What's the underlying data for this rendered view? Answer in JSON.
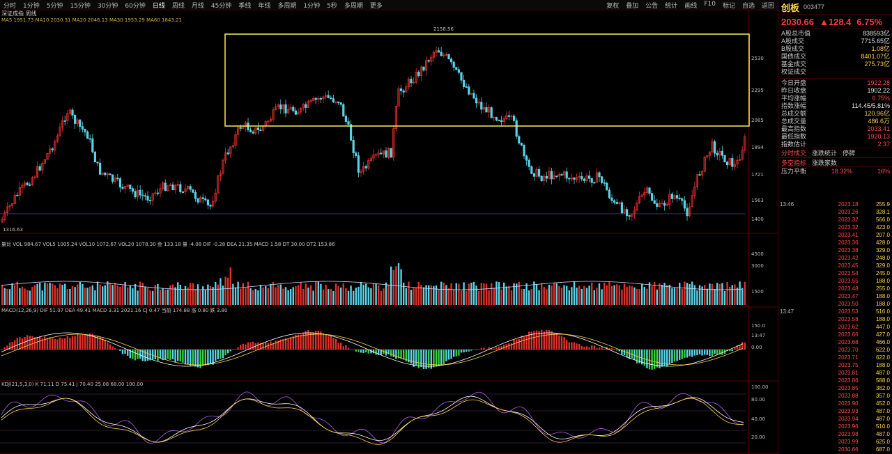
{
  "toolbar": {
    "left": [
      "分时",
      "1分钟",
      "5分钟",
      "15分钟",
      "30分钟",
      "60分钟",
      "日线",
      "周线",
      "月线",
      "45分钟",
      "季线",
      "年线",
      "多周期",
      "1分钟",
      "5秒",
      "多周期",
      "更多"
    ],
    "right": [
      "复权",
      "叠加",
      "公告",
      "统计",
      "画线",
      "F10",
      "标记",
      "自选",
      "返回"
    ]
  },
  "chart_header": {
    "title": "深证成指 周线",
    "ma_line": "MA5 1951.73  MA10 2030.31  MA20 2046.13  MA30 1953.29  MA60 1843.21",
    "high_label": "2158.56",
    "low_label": "1316.63"
  },
  "price_axis": [
    "2530",
    "2295",
    "2085",
    "1894",
    "1721",
    "1563",
    "1400"
  ],
  "volume_header": "量比 VOL 984.67  VOL5 1005.24  VOL10 1072.67  VOL20 1078.30  金 133.18  量 -4.08  DIF -0.28  DEA 21.35  MACD 1.58  DT 30.00  DT2 153.86",
  "volume_axis": [
    "4500",
    "3000",
    "1500"
  ],
  "macd_header": "MACD(12,26,9)  DIF 51.07  DEA 49.41  MACD 3.31  2021.16  CJ 0.47  当前 174.88  涨 0.80  跌 3.80",
  "macd_axis": [
    "150.0",
    "0.00"
  ],
  "kdj_header": "KDJ(21,5,3,0)  K 71.11  D 75.41  J 70.40  25.08  68.00  100.00",
  "kdj_axis": [
    "100.00",
    "80.00",
    "40.00",
    "20.00"
  ],
  "chart_data": {
    "type": "candlestick",
    "title": "",
    "x": [],
    "y_range": [
      1316.63,
      2158.56
    ],
    "panels": [
      "price",
      "volume",
      "macd",
      "kdj"
    ],
    "highlight_box": "consolidation zone (yellow rectangle)"
  },
  "side": {
    "name": "创板",
    "code": "003477",
    "price": "2030.66",
    "change": "▲128.4",
    "pct": "6.75%",
    "section": "A股总市值",
    "section_value": "838593亿",
    "rows1": [
      {
        "l": "A股成交",
        "v": "7715.65亿",
        "c": ""
      },
      {
        "l": "B股成交",
        "v": "1.08亿",
        "c": "yel"
      },
      {
        "l": "国债成交",
        "v": "8401.07亿",
        "c": "yel"
      },
      {
        "l": "基金成交",
        "v": "275.73亿",
        "c": "yel"
      },
      {
        "l": "权证成交",
        "v": "",
        "c": ""
      }
    ],
    "rows2": [
      {
        "l": "今日开盘",
        "v": "1922.28",
        "c": "red"
      },
      {
        "l": "昨日收盘",
        "v": "1902.22",
        "c": ""
      },
      {
        "l": "平均涨幅",
        "v": "6.75%",
        "c": "red"
      },
      {
        "l": "指数涨幅",
        "v": "114.45/5.81%",
        "c": ""
      },
      {
        "l": "总成交额",
        "v": "120.96亿",
        "c": "yel"
      },
      {
        "l": "总成交量",
        "v": "486.6万",
        "c": "yel"
      },
      {
        "l": "最高指数",
        "v": "2033.41",
        "c": "red"
      },
      {
        "l": "最低指数",
        "v": "1920.13",
        "c": "red"
      },
      {
        "l": "指数估计",
        "v": "2.37",
        "c": "red"
      }
    ],
    "tabs": [
      "分时成交",
      "涨跌统计",
      "停牌"
    ],
    "tabs2": [
      "多空指标",
      "涨跌家数"
    ],
    "pressure": {
      "l": "压力平衡",
      "v": "18.32%",
      "v2": "16%"
    },
    "ticks": [
      {
        "t": "13:46",
        "p": "2023.18",
        "v": "255.9"
      },
      {
        "t": "",
        "p": "2023.26",
        "v": "328.1"
      },
      {
        "t": "",
        "p": "2023.32",
        "v": "566.0"
      },
      {
        "t": "",
        "p": "2023.32",
        "v": "423.0"
      },
      {
        "t": "",
        "p": "2023.41",
        "v": "207.0"
      },
      {
        "t": "",
        "p": "2023.36",
        "v": "428.0"
      },
      {
        "t": "",
        "p": "2023.38",
        "v": "329.0"
      },
      {
        "t": "",
        "p": "2023.42",
        "v": "248.0"
      },
      {
        "t": "",
        "p": "2023.45",
        "v": "329.0"
      },
      {
        "t": "",
        "p": "2023.54",
        "v": "245.0"
      },
      {
        "t": "",
        "p": "2023.55",
        "v": "188.0"
      },
      {
        "t": "",
        "p": "2023.48",
        "v": "255.0"
      },
      {
        "t": "",
        "p": "2023.47",
        "v": "188.0"
      },
      {
        "t": "",
        "p": "2023.50",
        "v": "188.0"
      },
      {
        "t": "13:47",
        "p": "2023.53",
        "v": "516.0"
      },
      {
        "t": "",
        "p": "2023.58",
        "v": "188.0"
      },
      {
        "t": "",
        "p": "2023.62",
        "v": "447.0"
      },
      {
        "t": "",
        "p": "2023.66",
        "v": "427.0"
      },
      {
        "t": "",
        "p": "2023.68",
        "v": "466.0"
      },
      {
        "t": "",
        "p": "2023.70",
        "v": "622.0"
      },
      {
        "t": "",
        "p": "2023.71",
        "v": "622.0"
      },
      {
        "t": "",
        "p": "2023.75",
        "v": "188.0"
      },
      {
        "t": "",
        "p": "2023.81",
        "v": "487.0"
      },
      {
        "t": "",
        "p": "2023.86",
        "v": "588.0"
      },
      {
        "t": "",
        "p": "2023.85",
        "v": "382.0"
      },
      {
        "t": "",
        "p": "2023.88",
        "v": "357.0"
      },
      {
        "t": "",
        "p": "2023.90",
        "v": "452.0"
      },
      {
        "t": "",
        "p": "2023.93",
        "v": "487.0"
      },
      {
        "t": "",
        "p": "2023.94",
        "v": "487.0"
      },
      {
        "t": "",
        "p": "2023.96",
        "v": "510.0"
      },
      {
        "t": "",
        "p": "2023.98",
        "v": "487.0"
      },
      {
        "t": "",
        "p": "2023.99",
        "v": "625.0"
      },
      {
        "t": "",
        "p": "2030.66",
        "v": "687.0"
      }
    ]
  },
  "colors": {
    "up": "#e0302a",
    "down": "#5ad3e8",
    "box": "#ffef55",
    "bg": "#000000",
    "grid": "#3a0000"
  }
}
